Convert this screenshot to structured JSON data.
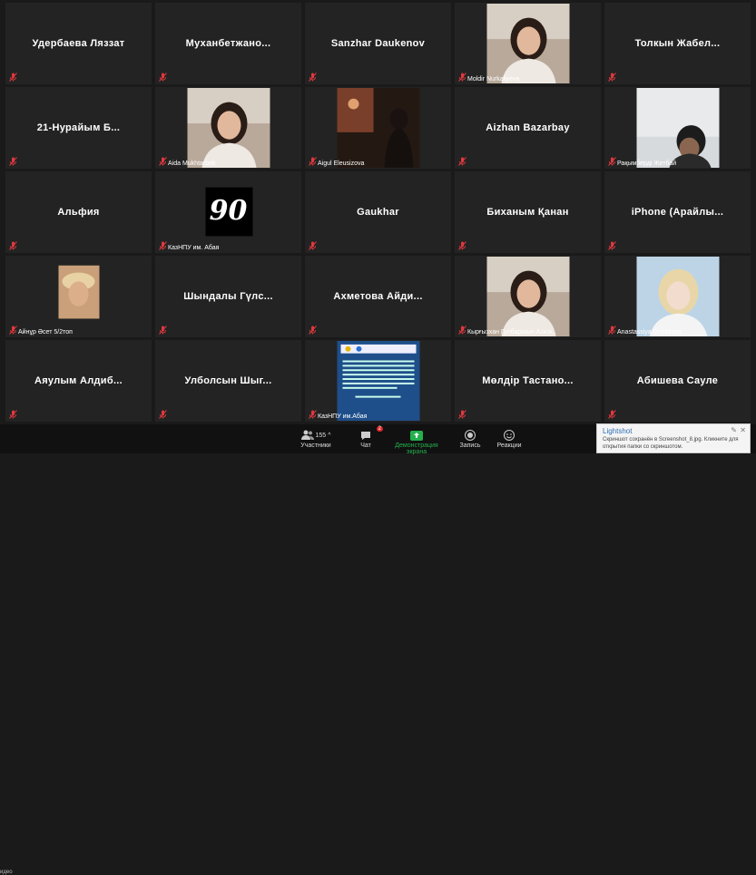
{
  "participants": [
    {
      "name": "Удербаева Ляззат"
    },
    {
      "name": "Муханбетжано..."
    },
    {
      "name": "Sanzhar Daukenov"
    },
    {
      "label": "Moldir Nurkaliyeva",
      "video": "portrait"
    },
    {
      "name": "Толкын Жабел..."
    },
    {
      "name": "21-Нурайым Б..."
    },
    {
      "label": "Aida Mukhtarbek",
      "video": "portrait"
    },
    {
      "label": "Aigul Elеusizova",
      "video": "dark-room"
    },
    {
      "name": "Aizhan Bazarbay"
    },
    {
      "label": "Рақымберді Жетбай",
      "video": "room"
    },
    {
      "name": "Альфия"
    },
    {
      "label": "КазНПУ им. Абая",
      "video": "logo-90",
      "logo_text": "90"
    },
    {
      "name": "Gaukhar"
    },
    {
      "name": "Биханым Қанан"
    },
    {
      "name": "iPhone (Арайлы..."
    },
    {
      "label": "Айнұр Әсет 5/2топ",
      "video": "photo-small"
    },
    {
      "name": "Шындалы Гүлс..."
    },
    {
      "name": "Ахметова Айди..."
    },
    {
      "label": "Кырғызхан Гулбаршын Азизк..",
      "video": "portrait"
    },
    {
      "label": "Anastassiya Grishkova",
      "video": "portrait-light"
    },
    {
      "name": "Аяулым Алдиб..."
    },
    {
      "name": "Улболсын Шыг..."
    },
    {
      "label": "КазНПУ им.Абая",
      "video": "slide"
    },
    {
      "name": "Мөлдір Тастано..."
    },
    {
      "name": "Абишева Сауле"
    }
  ],
  "toolbar": {
    "participants_label": "Участники",
    "participants_count": "155",
    "chat_label": "Чат",
    "chat_badge": "2",
    "share_label": "Демонстрация экрана",
    "record_label": "Запись",
    "reactions_label": "Реакции",
    "video_label": "идео"
  },
  "toast": {
    "title": "Lightshot",
    "message": "Скриншот сохранён в Screenshot_8.jpg. Кликните для открытия папки со скриншотом."
  },
  "colors": {
    "accent_green": "#23b14d",
    "mute_red": "#e0383e",
    "toast_title": "#2f6fb5"
  }
}
